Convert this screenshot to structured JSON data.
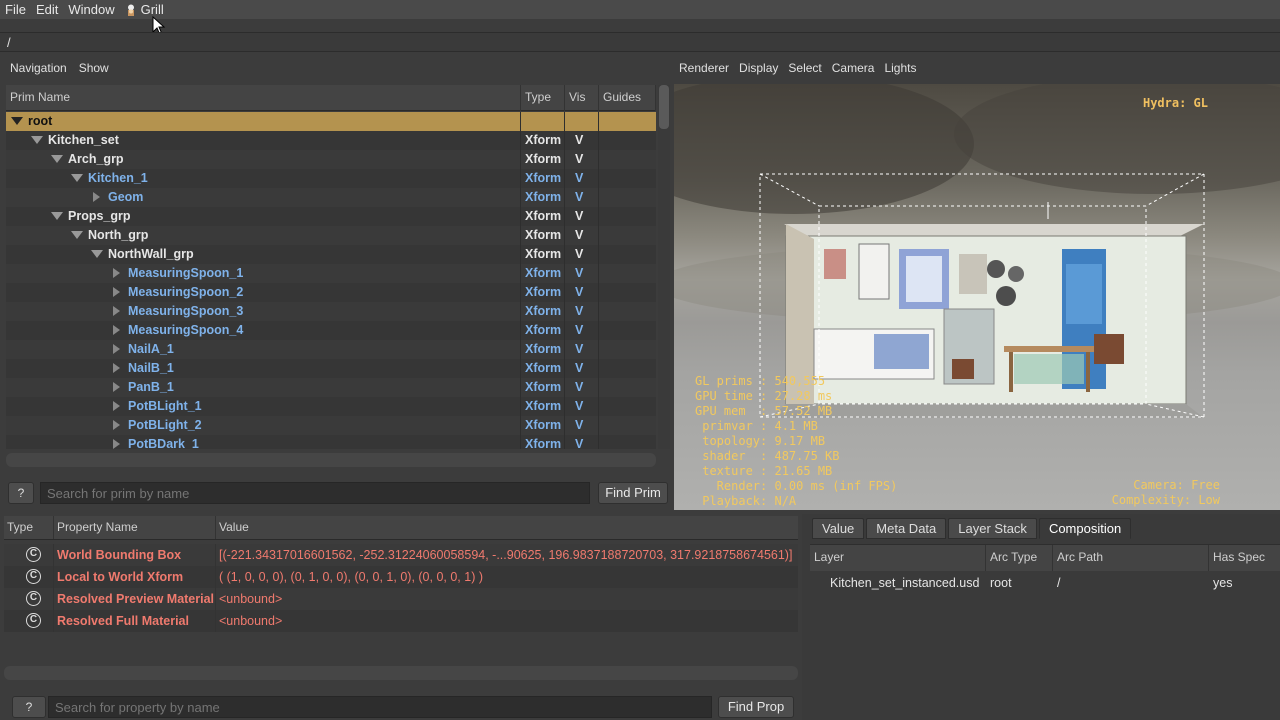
{
  "menubar": {
    "items": [
      "File",
      "Edit",
      "Window"
    ],
    "plugin": "Grill"
  },
  "path": "/",
  "tree": {
    "menu": [
      "Navigation",
      "Show"
    ],
    "columns": [
      "Prim Name",
      "Type",
      "Vis",
      "Guides"
    ],
    "rows": [
      {
        "name": "root",
        "type": "",
        "vis": "",
        "depth": 0,
        "expander": "down",
        "style": "sel"
      },
      {
        "name": "Kitchen_set",
        "type": "Xform",
        "vis": "V",
        "depth": 1,
        "expander": "down",
        "style": "white"
      },
      {
        "name": "Arch_grp",
        "type": "Xform",
        "vis": "V",
        "depth": 2,
        "expander": "down",
        "style": "white"
      },
      {
        "name": "Kitchen_1",
        "type": "Xform",
        "vis": "V",
        "depth": 3,
        "expander": "down",
        "style": "blue"
      },
      {
        "name": "Geom",
        "type": "Xform",
        "vis": "V",
        "depth": 4,
        "expander": "right",
        "style": "blue"
      },
      {
        "name": "Props_grp",
        "type": "Xform",
        "vis": "V",
        "depth": 2,
        "expander": "down",
        "style": "white"
      },
      {
        "name": "North_grp",
        "type": "Xform",
        "vis": "V",
        "depth": 3,
        "expander": "down",
        "style": "white"
      },
      {
        "name": "NorthWall_grp",
        "type": "Xform",
        "vis": "V",
        "depth": 4,
        "expander": "down",
        "style": "white"
      },
      {
        "name": "MeasuringSpoon_1",
        "type": "Xform",
        "vis": "V",
        "depth": 5,
        "expander": "right",
        "style": "blue"
      },
      {
        "name": "MeasuringSpoon_2",
        "type": "Xform",
        "vis": "V",
        "depth": 5,
        "expander": "right",
        "style": "blue"
      },
      {
        "name": "MeasuringSpoon_3",
        "type": "Xform",
        "vis": "V",
        "depth": 5,
        "expander": "right",
        "style": "blue"
      },
      {
        "name": "MeasuringSpoon_4",
        "type": "Xform",
        "vis": "V",
        "depth": 5,
        "expander": "right",
        "style": "blue"
      },
      {
        "name": "NailA_1",
        "type": "Xform",
        "vis": "V",
        "depth": 5,
        "expander": "right",
        "style": "blue"
      },
      {
        "name": "NailB_1",
        "type": "Xform",
        "vis": "V",
        "depth": 5,
        "expander": "right",
        "style": "blue"
      },
      {
        "name": "PanB_1",
        "type": "Xform",
        "vis": "V",
        "depth": 5,
        "expander": "right",
        "style": "blue"
      },
      {
        "name": "PotBLight_1",
        "type": "Xform",
        "vis": "V",
        "depth": 5,
        "expander": "right",
        "style": "blue"
      },
      {
        "name": "PotBLight_2",
        "type": "Xform",
        "vis": "V",
        "depth": 5,
        "expander": "right",
        "style": "blue"
      },
      {
        "name": "PotBDark_1",
        "type": "Xform",
        "vis": "V",
        "depth": 5,
        "expander": "right",
        "style": "blue"
      }
    ],
    "search_placeholder": "Search for prim by name",
    "help_label": "?",
    "find_label": "Find Prim"
  },
  "viewport": {
    "menu": [
      "Renderer",
      "Display",
      "Select",
      "Camera",
      "Lights"
    ],
    "renderer_label": "Hydra: GL",
    "stats": [
      "GL prims : 540,555",
      "GPU time : 27.28 ms",
      "GPU mem  : 57.52 MB",
      " primvar : 4.1 MB",
      " topology: 9.17 MB",
      " shader  : 487.75 KB",
      " texture : 21.65 MB",
      "   Render: 0.00 ms (inf FPS)",
      " Playback: N/A"
    ],
    "camera": [
      "Camera: Free",
      "Complexity: Low"
    ]
  },
  "properties": {
    "columns": [
      "Type",
      "Property Name",
      "Value"
    ],
    "rows": [
      {
        "name": "World Bounding Box",
        "value": "[(-221.34317016601562, -252.31224060058594, -...90625, 196.9837188720703, 317.9218758674561)]"
      },
      {
        "name": "Local to World Xform",
        "value": "( (1, 0, 0, 0), (0, 1, 0, 0), (0, 0, 1, 0), (0, 0, 0, 1) )"
      },
      {
        "name": "Resolved Preview Material",
        "value": "<unbound>"
      },
      {
        "name": "Resolved Full Material",
        "value": "<unbound>"
      }
    ],
    "type_glyph": "C",
    "search_placeholder": "Search for property by name",
    "help_label": "?",
    "find_label": "Find Prop"
  },
  "composition": {
    "tabs": [
      "Value",
      "Meta Data",
      "Layer Stack",
      "Composition"
    ],
    "active_tab": "Composition",
    "columns": [
      "Layer",
      "Arc Type",
      "Arc Path",
      "Has Spec"
    ],
    "rows": [
      {
        "layer": "Kitchen_set_instanced.usd",
        "arc_type": "root",
        "arc_path": "/",
        "has_spec": "yes"
      }
    ]
  },
  "colors": {
    "selection": "#b4934f",
    "prim_blue": "#7fb2ea",
    "property_red": "#f07a6e",
    "hud_yellow": "#f2c95e"
  }
}
